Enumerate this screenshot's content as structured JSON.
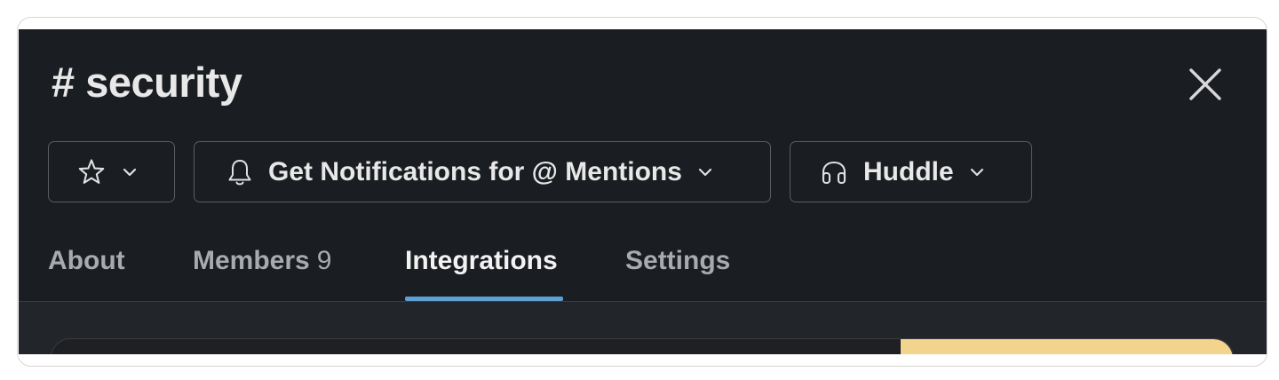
{
  "channel": {
    "title": "# security"
  },
  "toolbar": {
    "star_icon": "star-icon",
    "notifications_label": "Get Notifications for @ Mentions",
    "notifications_icon": "bell-icon",
    "huddle_label": "Huddle",
    "huddle_icon": "headphones-icon",
    "chevron_icon": "chevron-down-icon"
  },
  "tabs": [
    {
      "label": "About",
      "count": "",
      "active": false
    },
    {
      "label": "Members",
      "count": "9",
      "active": false
    },
    {
      "label": "Integrations",
      "count": "",
      "active": true
    },
    {
      "label": "Settings",
      "count": "",
      "active": false
    }
  ],
  "colors": {
    "panel_background": "#1a1d21",
    "content_background": "#222529",
    "text_primary": "#e8e8e8",
    "text_muted": "#a9aaad",
    "active_tab_underline": "#5ea0d4",
    "card_accent": "#f2d48c"
  }
}
